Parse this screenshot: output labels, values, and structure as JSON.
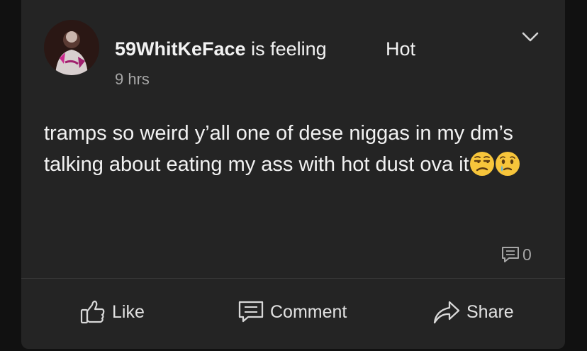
{
  "post": {
    "author": "59WhitKeFace",
    "feeling_label": "is feeling",
    "mood": "Hot",
    "timestamp": "9 hrs",
    "text": "tramps so weird y’all one of dese niggas in my dm’s talking about eating my ass with hot dust ova it",
    "emojis": [
      "unamused-face",
      "face-holding-back-tears"
    ],
    "comment_count": "0"
  },
  "actions": {
    "like_label": "Like",
    "comment_label": "Comment",
    "share_label": "Share"
  },
  "colors": {
    "background": "#111111",
    "card": "#242424",
    "text_primary": "#f2f2f2",
    "text_secondary": "#a7a7a7",
    "divider": "#3a3a3a"
  }
}
